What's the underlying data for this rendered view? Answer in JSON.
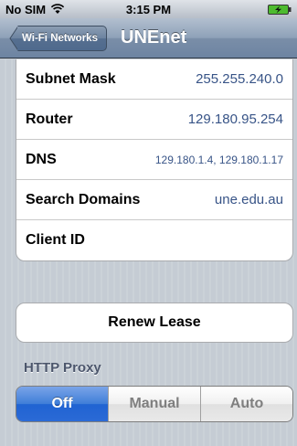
{
  "status_bar": {
    "carrier": "No SIM",
    "time": "3:15 PM",
    "icons": [
      "wifi-icon",
      "battery-charging-icon"
    ]
  },
  "nav": {
    "back_label": "Wi-Fi Networks",
    "title": "UNEnet"
  },
  "details": [
    {
      "label": "Subnet Mask",
      "value": "255.255.240.0"
    },
    {
      "label": "Router",
      "value": "129.180.95.254"
    },
    {
      "label": "DNS",
      "value": "129.180.1.4, 129.180.1.17"
    },
    {
      "label": "Search Domains",
      "value": "une.edu.au"
    },
    {
      "label": "Client ID",
      "value": ""
    }
  ],
  "renew_label": "Renew Lease",
  "proxy": {
    "header": "HTTP Proxy",
    "options": [
      "Off",
      "Manual",
      "Auto"
    ],
    "selected": "Off"
  },
  "colors": {
    "value_text": "#385487",
    "selected_segment": "#2b6ad6",
    "nav_bar": "#6d84a2"
  }
}
